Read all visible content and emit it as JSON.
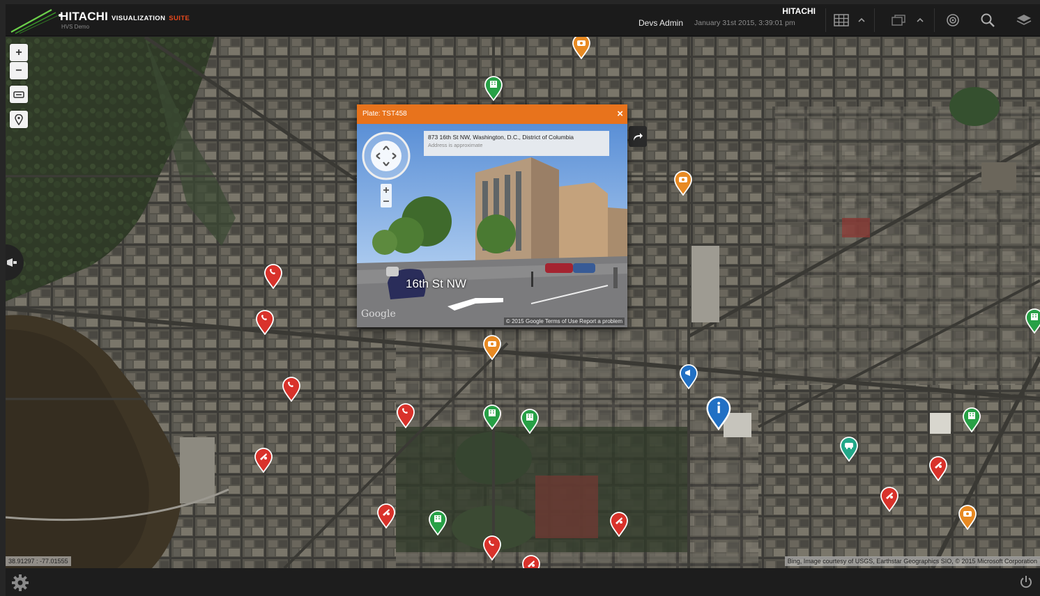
{
  "header": {
    "brand_main": "HITACHI",
    "brand_sub": "VISUALIZATION",
    "brand_suite": "SUITE",
    "brand_note": "HVS Demo",
    "company": "HITACHI",
    "user": "Devs Admin",
    "datetime": "January 31st 2015, 3:39:01 pm",
    "toolbar_icons": [
      "grid-icon",
      "chevron-up-icon",
      "windows-icon",
      "chevron-up-icon",
      "target-icon",
      "search-icon",
      "layers-icon"
    ]
  },
  "map": {
    "controls": {
      "zoom_in": "+",
      "zoom_out": "−"
    },
    "coords": "38.91297 : -77.01555",
    "attribution": "Bing, Image courtesy of USGS, Earthstar Geographics SIO, © 2015 Microsoft Corporation"
  },
  "popup": {
    "title": "Plate: TST458",
    "close": "×",
    "address": "873 16th St NW, Washington, D.C., District of Columbia",
    "address_note": "Address is approximate",
    "street": "16th St NW",
    "watermark": "Google",
    "copyright": "© 2015 Google  Terms of Use  Report a problem"
  },
  "marker_colors": {
    "red": "#d9322b",
    "green": "#27a046",
    "orange": "#e88a23",
    "blue": "#2170c4",
    "teal": "#22a889"
  },
  "markers": [
    {
      "type": "orange",
      "icon": "camera-icon"
    },
    {
      "type": "green",
      "icon": "building-icon"
    },
    {
      "type": "orange",
      "icon": "camera-icon"
    },
    {
      "type": "red",
      "icon": "phone-icon"
    },
    {
      "type": "red",
      "icon": "phone-icon"
    },
    {
      "type": "red",
      "icon": "phone-icon"
    },
    {
      "type": "orange",
      "icon": "camera-icon"
    },
    {
      "type": "red",
      "icon": "phone-icon"
    },
    {
      "type": "green",
      "icon": "building-icon"
    },
    {
      "type": "green",
      "icon": "building-icon"
    },
    {
      "type": "blue",
      "icon": "megaphone-icon"
    },
    {
      "type": "blue",
      "icon": "info-icon"
    },
    {
      "type": "red",
      "icon": "alarm-icon"
    },
    {
      "type": "green",
      "icon": "building-icon"
    },
    {
      "type": "teal",
      "icon": "bus-icon"
    },
    {
      "type": "green",
      "icon": "building-icon"
    },
    {
      "type": "red",
      "icon": "alarm-icon"
    },
    {
      "type": "red",
      "icon": "alarm-icon"
    },
    {
      "type": "red",
      "icon": "alarm-icon"
    },
    {
      "type": "red",
      "icon": "alarm-icon"
    },
    {
      "type": "orange",
      "icon": "camera-icon"
    },
    {
      "type": "red",
      "icon": "phone-icon"
    },
    {
      "type": "red",
      "icon": "alarm-icon"
    },
    {
      "type": "green",
      "icon": "building-icon"
    },
    {
      "type": "teal",
      "icon": "building-icon"
    }
  ]
}
